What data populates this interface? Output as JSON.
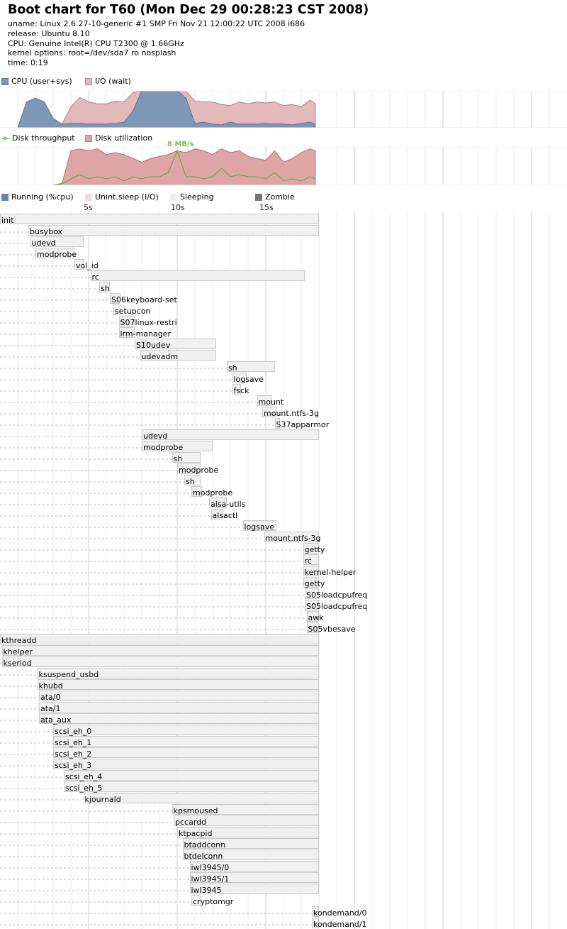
{
  "header": {
    "title": "Boot chart for T60 (Mon Dec 29 00:28:23 CST 2008)",
    "uname": "uname: Linux 2.6.27-10-generic #1 SMP Fri Nov 21 12:00:22 UTC 2008 i686",
    "release": "release: Ubuntu 8.10",
    "cpu": "CPU: Genuine Intel(R) CPU T2300 @ 1.66GHz",
    "kernel_options": "kernel options: root=/dev/sda7 ro nosplash",
    "time": "time: 0:19"
  },
  "legend": {
    "cpu": "CPU (user+sys)",
    "io": "I/O (wait)",
    "disk_throughput": "Disk throughput",
    "disk_util": "Disk utilization",
    "running": "Running (%cpu)",
    "unint": "Unint.sleep (I/O)",
    "sleeping": "Sleeping",
    "zombie": "Zombie"
  },
  "colors": {
    "cpu": "#7f97b7",
    "io": "#e3b9ba",
    "disk_util": "#dea4a6",
    "throughput": "#5ab02e",
    "running": "#5f86ad",
    "unint": "#d7adae",
    "sleeping": "#f0f0f0",
    "zombie": "#777777",
    "grid": "#e2e2e2"
  },
  "chart_data": [
    {
      "type": "area",
      "title": "CPU (user+sys) / I/O (wait)",
      "x_unit": "s",
      "xlim": [
        0,
        18
      ],
      "ylim": [
        0,
        100
      ],
      "x": [
        0,
        0.5,
        1,
        1.5,
        2,
        2.5,
        3,
        3.5,
        4,
        4.5,
        5,
        5.5,
        6,
        6.5,
        7,
        7.5,
        8,
        8.5,
        9,
        9.5,
        10,
        10.5,
        11,
        11.5,
        12,
        12.5,
        13,
        13.5,
        14,
        14.5,
        15,
        15.5,
        16,
        16.5,
        17,
        17.5,
        17.8
      ],
      "series": [
        {
          "name": "CPU (user+sys)",
          "values": [
            0,
            0,
            0,
            0,
            0,
            0,
            0,
            0,
            0,
            0,
            0,
            0,
            0,
            0,
            0,
            0,
            0,
            0,
            0,
            0,
            0,
            0,
            0,
            0,
            0,
            0,
            0,
            0,
            0,
            0,
            0,
            0,
            0,
            0,
            0,
            0,
            0
          ]
        },
        {
          "name": "I/O (wait)",
          "values": [
            0,
            0,
            0,
            0,
            0,
            0,
            0,
            0,
            0,
            0,
            0,
            0,
            0,
            0,
            0,
            0,
            0,
            0,
            0,
            0,
            0,
            0,
            0,
            0,
            0,
            0,
            0,
            0,
            0,
            0,
            0,
            0,
            0,
            0,
            0,
            0,
            0
          ]
        }
      ],
      "cpu_values": [
        0,
        0,
        0,
        70,
        80,
        70,
        25,
        10,
        12,
        12,
        10,
        10,
        10,
        12,
        15,
        45,
        100,
        100,
        100,
        100,
        100,
        80,
        12,
        15,
        10,
        8,
        15,
        10,
        10,
        10,
        12,
        10,
        10,
        8,
        12,
        15,
        10
      ],
      "io_values": [
        0,
        0,
        0,
        0,
        0,
        0,
        0,
        0,
        45,
        70,
        60,
        55,
        55,
        60,
        55,
        50,
        0,
        0,
        0,
        0,
        0,
        20,
        60,
        55,
        60,
        55,
        45,
        60,
        55,
        60,
        55,
        60,
        50,
        55,
        45,
        60,
        55
      ]
    },
    {
      "type": "area",
      "title": "Disk throughput / Disk utilization",
      "annotation": "8 MB/s",
      "x_unit": "s",
      "xlim": [
        0,
        18
      ],
      "x": [
        0,
        0.5,
        1,
        1.5,
        2,
        2.5,
        3,
        3.5,
        4,
        4.5,
        5,
        5.5,
        6,
        6.5,
        7,
        7.5,
        8,
        8.5,
        9,
        9.5,
        10,
        10.5,
        11,
        11.5,
        12,
        12.5,
        13,
        13.5,
        14,
        14.5,
        15,
        15.5,
        16,
        16.5,
        17,
        17.5,
        17.8
      ],
      "disk_util": [
        0,
        0,
        0,
        0,
        0,
        0,
        0,
        5,
        90,
        95,
        90,
        95,
        80,
        85,
        80,
        70,
        60,
        70,
        75,
        80,
        90,
        85,
        95,
        90,
        80,
        95,
        85,
        90,
        75,
        70,
        65,
        90,
        60,
        70,
        85,
        95,
        90
      ],
      "throughput_mbps": [
        0,
        0,
        0,
        0,
        0,
        0,
        0,
        0.3,
        1.5,
        2.5,
        1.5,
        2,
        1.5,
        2,
        1,
        2,
        1.5,
        2,
        2,
        3,
        8,
        2,
        2,
        1.5,
        2,
        4,
        2,
        2.5,
        2,
        2,
        1.5,
        3,
        1,
        1.5,
        1,
        2,
        1.5
      ]
    }
  ],
  "time_ticks": [
    "5s",
    "10s",
    "15s"
  ],
  "processes": [
    {
      "name": "init",
      "start": 0,
      "end": 18,
      "depth": 0
    },
    {
      "name": "busybox",
      "start": 1.6,
      "end": 18,
      "depth": 1
    },
    {
      "name": "udevd",
      "start": 1.7,
      "end": 4.7,
      "depth": 2
    },
    {
      "name": "modprobe",
      "start": 2.0,
      "end": 4.2,
      "depth": 2
    },
    {
      "name": "vol_id",
      "start": 4.2,
      "end": 4.7,
      "depth": 2
    },
    {
      "name": "rc",
      "start": 5.1,
      "end": 17.2,
      "depth": 1
    },
    {
      "name": "sh",
      "start": 5.6,
      "end": 6.2,
      "depth": 2
    },
    {
      "name": "S06keyboard-set",
      "start": 6.2,
      "end": 6.8,
      "depth": 3
    },
    {
      "name": "setupcon",
      "start": 6.4,
      "end": 6.8,
      "depth": 4
    },
    {
      "name": "S07linux-restri",
      "start": 6.7,
      "end": 7.6,
      "depth": 3
    },
    {
      "name": "lrm-manager",
      "start": 6.7,
      "end": 7.6,
      "depth": 4
    },
    {
      "name": "S10udev",
      "start": 7.6,
      "end": 12.2,
      "depth": 3
    },
    {
      "name": "udevadm",
      "start": 7.9,
      "end": 12.2,
      "depth": 4
    },
    {
      "name": "sh",
      "start": 12.8,
      "end": 15.5,
      "depth": 2
    },
    {
      "name": "logsave",
      "start": 13.1,
      "end": 13.9,
      "depth": 3
    },
    {
      "name": "fsck",
      "start": 13.1,
      "end": 13.6,
      "depth": 4
    },
    {
      "name": "mount",
      "start": 14.5,
      "end": 15.3,
      "depth": 3
    },
    {
      "name": "mount.ntfs-3g",
      "start": 14.8,
      "end": 15.6,
      "depth": 4
    },
    {
      "name": "S37apparmor",
      "start": 15.5,
      "end": 15.8,
      "depth": 3
    },
    {
      "name": "udevd",
      "start": 8.0,
      "end": 18,
      "depth": 1
    },
    {
      "name": "modprobe",
      "start": 8.0,
      "end": 12.0,
      "depth": 2
    },
    {
      "name": "sh",
      "start": 9.7,
      "end": 11.3,
      "depth": 3
    },
    {
      "name": "modprobe",
      "start": 10.0,
      "end": 11.3,
      "depth": 4
    },
    {
      "name": "sh",
      "start": 10.4,
      "end": 11.3,
      "depth": 5
    },
    {
      "name": "modprobe",
      "start": 10.8,
      "end": 11.4,
      "depth": 6
    },
    {
      "name": "alsa-utils",
      "start": 11.8,
      "end": 12.8,
      "depth": 3
    },
    {
      "name": "alsactl",
      "start": 11.9,
      "end": 12.6,
      "depth": 4
    },
    {
      "name": "logsave",
      "start": 13.7,
      "end": 15.6,
      "depth": 1
    },
    {
      "name": "mount.ntfs-3g",
      "start": 14.9,
      "end": 18,
      "depth": 1
    },
    {
      "name": "getty",
      "start": 17.1,
      "end": 18,
      "depth": 1
    },
    {
      "name": "rc",
      "start": 17.1,
      "end": 18,
      "depth": 1
    },
    {
      "name": "kernel-helper",
      "start": 17.1,
      "end": 18,
      "depth": 2
    },
    {
      "name": "getty",
      "start": 17.1,
      "end": 18,
      "depth": 1
    },
    {
      "name": "S05loadcpufreq",
      "start": 17.2,
      "end": 18,
      "depth": 2
    },
    {
      "name": "S05loadcpufreq",
      "start": 17.2,
      "end": 18,
      "depth": 3
    },
    {
      "name": "awk",
      "start": 17.3,
      "end": 18,
      "depth": 4
    },
    {
      "name": "S05vbesave",
      "start": 17.3,
      "end": 18,
      "depth": 2
    },
    {
      "name": "kthreadd",
      "start": 0,
      "end": 18,
      "depth": 0
    },
    {
      "name": "khelper",
      "start": 0.1,
      "end": 18,
      "depth": 1
    },
    {
      "name": "kseriod",
      "start": 0.1,
      "end": 18,
      "depth": 1
    },
    {
      "name": "ksuspend_usbd",
      "start": 2.1,
      "end": 18,
      "depth": 1
    },
    {
      "name": "khubd",
      "start": 2.1,
      "end": 18,
      "depth": 1
    },
    {
      "name": "ata/0",
      "start": 2.2,
      "end": 18,
      "depth": 1
    },
    {
      "name": "ata/1",
      "start": 2.2,
      "end": 18,
      "depth": 1
    },
    {
      "name": "ata_aux",
      "start": 2.2,
      "end": 18,
      "depth": 1
    },
    {
      "name": "scsi_eh_0",
      "start": 3.0,
      "end": 18,
      "depth": 1
    },
    {
      "name": "scsi_eh_1",
      "start": 3.0,
      "end": 18,
      "depth": 1
    },
    {
      "name": "scsi_eh_2",
      "start": 3.0,
      "end": 18,
      "depth": 1
    },
    {
      "name": "scsi_eh_3",
      "start": 3.0,
      "end": 18,
      "depth": 1
    },
    {
      "name": "scsi_eh_4",
      "start": 3.6,
      "end": 18,
      "depth": 1
    },
    {
      "name": "scsi_eh_5",
      "start": 3.6,
      "end": 18,
      "depth": 1
    },
    {
      "name": "kjournald",
      "start": 4.7,
      "end": 18,
      "depth": 1
    },
    {
      "name": "kpsmoused",
      "start": 9.7,
      "end": 18,
      "depth": 1
    },
    {
      "name": "pccardd",
      "start": 9.8,
      "end": 18,
      "depth": 1
    },
    {
      "name": "ktpacpid",
      "start": 10.0,
      "end": 18,
      "depth": 1
    },
    {
      "name": "btaddconn",
      "start": 10.3,
      "end": 18,
      "depth": 1
    },
    {
      "name": "btdelconn",
      "start": 10.3,
      "end": 18,
      "depth": 1
    },
    {
      "name": "iwl3945/0",
      "start": 10.7,
      "end": 18,
      "depth": 1
    },
    {
      "name": "iwl3945/1",
      "start": 10.7,
      "end": 18,
      "depth": 1
    },
    {
      "name": "iwl3945",
      "start": 10.7,
      "end": 18,
      "depth": 1
    },
    {
      "name": "cryptomgr",
      "start": 10.8,
      "end": 11.3,
      "depth": 1
    },
    {
      "name": "kondemand/0",
      "start": 17.6,
      "end": 18,
      "depth": 1
    },
    {
      "name": "kondemand/1",
      "start": 17.6,
      "end": 18,
      "depth": 1
    }
  ]
}
